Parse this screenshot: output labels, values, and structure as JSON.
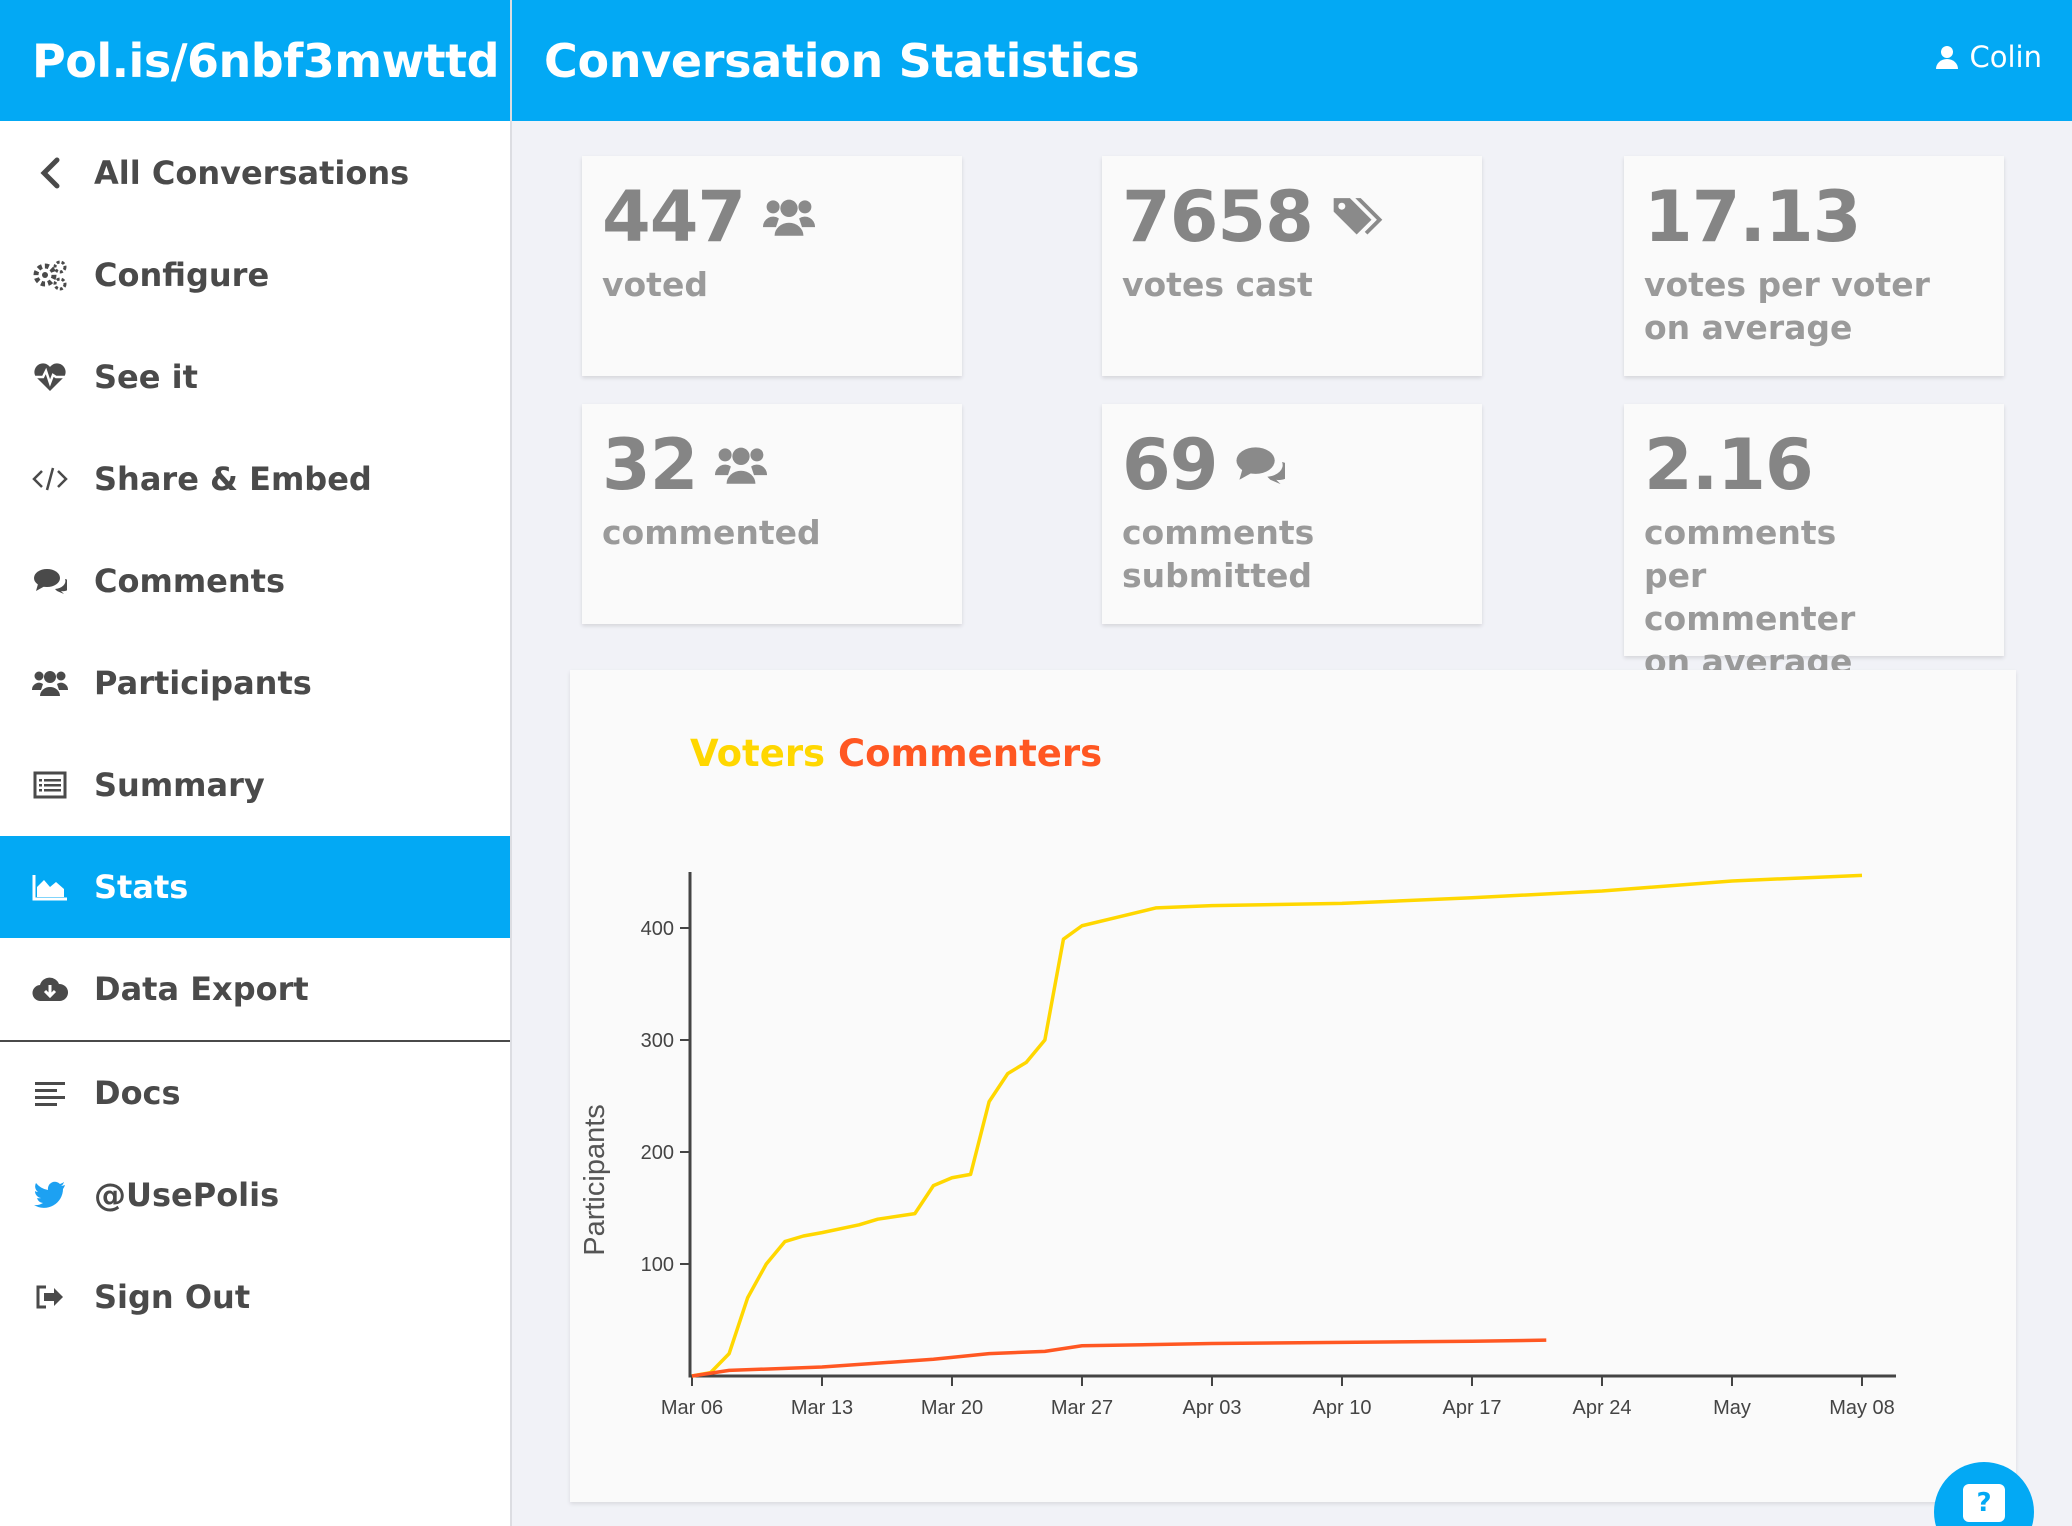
{
  "brand": "Pol.is/6nbf3mwttd",
  "header": {
    "title": "Conversation Statistics",
    "user": "Colin"
  },
  "sidebar": {
    "items": [
      {
        "label": "All Conversations",
        "icon": "chevron-left-icon"
      },
      {
        "label": "Configure",
        "icon": "gears-icon"
      },
      {
        "label": "See it",
        "icon": "heartbeat-icon"
      },
      {
        "label": "Share & Embed",
        "icon": "code-icon"
      },
      {
        "label": "Comments",
        "icon": "comments-icon"
      },
      {
        "label": "Participants",
        "icon": "users-icon"
      },
      {
        "label": "Summary",
        "icon": "list-alt-icon"
      },
      {
        "label": "Stats",
        "icon": "area-chart-icon",
        "active": true
      },
      {
        "label": "Data Export",
        "icon": "cloud-download-icon"
      }
    ],
    "secondary": [
      {
        "label": "Docs",
        "icon": "align-left-icon"
      },
      {
        "label": "@UsePolis",
        "icon": "twitter-icon"
      },
      {
        "label": "Sign Out",
        "icon": "sign-out-icon"
      }
    ]
  },
  "stats": {
    "voted": {
      "value": "447",
      "label": "voted",
      "icon": "users-icon"
    },
    "votes_cast": {
      "value": "7658",
      "label": "votes cast",
      "icon": "tags-icon"
    },
    "votes_per_voter": {
      "value": "17.13",
      "label": "votes per voter on average"
    },
    "commented": {
      "value": "32",
      "label": "commented",
      "icon": "users-icon"
    },
    "comments_submitted": {
      "value": "69",
      "label": "comments submitted",
      "icon": "comments-icon"
    },
    "comments_per_commenter": {
      "value": "2.16",
      "label": "comments per commenter on average"
    }
  },
  "colors": {
    "accent": "#03a9f4",
    "voters": "#ffd700",
    "commenters": "#ff5722"
  },
  "help": {
    "label": "?"
  },
  "chart_data": {
    "type": "line",
    "title": "",
    "xlabel": "",
    "ylabel": "Participants",
    "ylim": [
      0,
      450
    ],
    "x_ticks": [
      "Mar 06",
      "Mar 13",
      "Mar 20",
      "Mar 27",
      "Apr 03",
      "Apr 10",
      "Apr 17",
      "Apr 24",
      "May",
      "May 08"
    ],
    "y_ticks": [
      100,
      200,
      300,
      400
    ],
    "grid": false,
    "series": [
      {
        "name": "Voters",
        "color": "#ffd700",
        "points": [
          [
            "Mar 06",
            0
          ],
          [
            "Mar 07",
            3
          ],
          [
            "Mar 08",
            20
          ],
          [
            "Mar 09",
            70
          ],
          [
            "Mar 10",
            100
          ],
          [
            "Mar 11",
            120
          ],
          [
            "Mar 12",
            125
          ],
          [
            "Mar 13",
            128
          ],
          [
            "Mar 15",
            135
          ],
          [
            "Mar 16",
            140
          ],
          [
            "Mar 18",
            145
          ],
          [
            "Mar 19",
            170
          ],
          [
            "Mar 20",
            177
          ],
          [
            "Mar 21",
            180
          ],
          [
            "Mar 22",
            245
          ],
          [
            "Mar 23",
            270
          ],
          [
            "Mar 24",
            280
          ],
          [
            "Mar 25",
            300
          ],
          [
            "Mar 26",
            390
          ],
          [
            "Mar 27",
            402
          ],
          [
            "Mar 29",
            410
          ],
          [
            "Mar 31",
            418
          ],
          [
            "Apr 03",
            420
          ],
          [
            "Apr 10",
            422
          ],
          [
            "Apr 17",
            427
          ],
          [
            "Apr 24",
            433
          ],
          [
            "May 01",
            442
          ],
          [
            "May 08",
            447
          ]
        ]
      },
      {
        "name": "Commenters",
        "color": "#ff5722",
        "points": [
          [
            "Mar 06",
            0
          ],
          [
            "Mar 08",
            5
          ],
          [
            "Mar 13",
            8
          ],
          [
            "Mar 19",
            15
          ],
          [
            "Mar 22",
            20
          ],
          [
            "Mar 25",
            22
          ],
          [
            "Mar 27",
            27
          ],
          [
            "Apr 03",
            29
          ],
          [
            "Apr 10",
            30
          ],
          [
            "Apr 17",
            31
          ],
          [
            "Apr 21",
            32
          ]
        ]
      }
    ]
  }
}
